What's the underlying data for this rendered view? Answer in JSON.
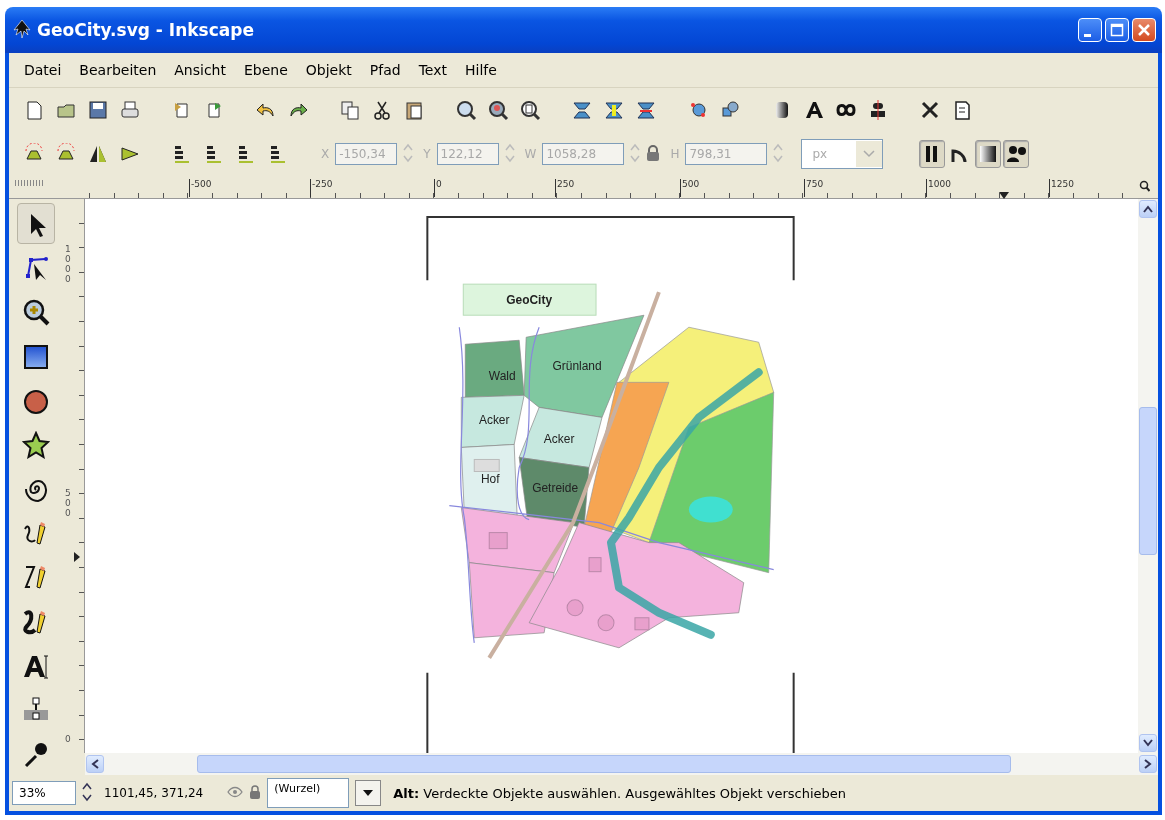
{
  "window": {
    "title": "GeoCity.svg - Inkscape"
  },
  "menu": [
    {
      "label": "Datei"
    },
    {
      "label": "Bearbeiten"
    },
    {
      "label": "Ansicht"
    },
    {
      "label": "Ebene"
    },
    {
      "label": "Objekt"
    },
    {
      "label": "Pfad"
    },
    {
      "label": "Text"
    },
    {
      "label": "Hilfe"
    }
  ],
  "transform": {
    "fields": [
      {
        "label": "X",
        "value": "-150,34",
        "disabled": true
      },
      {
        "label": "Y",
        "value": "122,12",
        "disabled": true
      },
      {
        "label": "W",
        "value": "1058,28",
        "disabled": true
      },
      {
        "label": "H",
        "value": "798,31",
        "disabled": true
      }
    ],
    "unit": {
      "value": "px",
      "disabled": true
    }
  },
  "toggles": [
    {
      "on": true
    },
    {
      "on": false
    },
    {
      "on": true
    },
    {
      "on": true
    }
  ],
  "ruler": {
    "h_labels": [
      "-500",
      "-250",
      "0",
      "250",
      "500",
      "750",
      "1000",
      "1250"
    ],
    "v_labels": [
      "1000",
      "500",
      "0"
    ]
  },
  "toolbox": [
    {
      "selected": true
    },
    {
      "selected": false
    },
    {
      "selected": false
    },
    {
      "selected": false
    },
    {
      "selected": false
    },
    {
      "selected": false
    },
    {
      "selected": false
    },
    {
      "selected": false
    },
    {
      "selected": false
    },
    {
      "selected": false
    },
    {
      "selected": false
    },
    {
      "selected": false
    },
    {
      "selected": false
    }
  ],
  "map": {
    "title": "GeoCity",
    "labels": [
      "Wald",
      "Grünland",
      "Acker",
      "Acker",
      "Hof",
      "Getreide"
    ]
  },
  "status_bar": {
    "zoom": "33%",
    "coords": "1101,45, 371,24",
    "layer": "(Wurzel)",
    "message": "**Alt:** Verdeckte Objekte auswählen. Ausgewähltes Objekt verschieben"
  }
}
